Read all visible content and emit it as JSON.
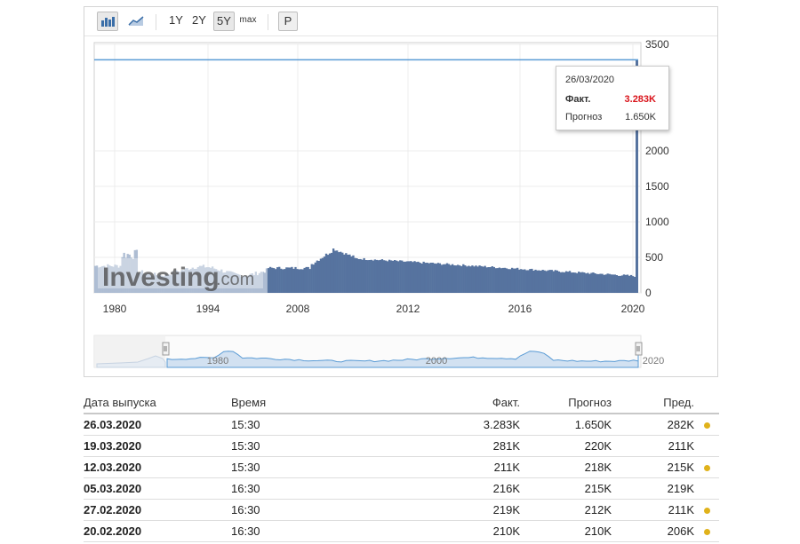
{
  "toolbar": {
    "bar_icon": "bar-chart-icon",
    "line_icon": "line-chart-icon",
    "ranges": [
      "1Y",
      "2Y",
      "5Y",
      "max"
    ],
    "selected_range": "5Y",
    "p_label": "P"
  },
  "chart_data": {
    "type": "bar",
    "y_ticks": [
      "3500",
      "2000",
      "1500",
      "1000",
      "500",
      "0"
    ],
    "x_ticks": [
      "1980",
      "1994",
      "2008",
      "2012",
      "2016",
      "2020"
    ],
    "ylim": [
      0,
      3500
    ],
    "spike_value": 3283,
    "grid": true,
    "watermark": "Investing.com",
    "navigator_labels": [
      "1980",
      "2000",
      "2020"
    ],
    "colors": {
      "bars": "#56739f",
      "bars_faded": "#aebdd3",
      "line": "#5a9bd5"
    }
  },
  "tooltip": {
    "date": "26/03/2020",
    "actual_label": "Факт.",
    "actual_value": "3.283K",
    "forecast_label": "Прогноз",
    "forecast_value": "1.650K"
  },
  "table": {
    "headers": {
      "date": "Дата выпуска",
      "time": "Время",
      "actual": "Факт.",
      "forecast": "Прогноз",
      "previous": "Пред."
    },
    "rows": [
      {
        "date": "26.03.2020",
        "time": "15:30",
        "actual": "3.283K",
        "actual_color": "red",
        "forecast": "1.650K",
        "previous": "282K",
        "previous_color": "red",
        "dot": true
      },
      {
        "date": "19.03.2020",
        "time": "15:30",
        "actual": "281K",
        "actual_color": "red",
        "forecast": "220K",
        "previous": "211K",
        "previous_color": "black",
        "dot": false
      },
      {
        "date": "12.03.2020",
        "time": "15:30",
        "actual": "211K",
        "actual_color": "green",
        "forecast": "218K",
        "previous": "215K",
        "previous_color": "green",
        "dot": true
      },
      {
        "date": "05.03.2020",
        "time": "16:30",
        "actual": "216K",
        "actual_color": "red",
        "forecast": "215K",
        "previous": "219K",
        "previous_color": "black",
        "dot": false
      },
      {
        "date": "27.02.2020",
        "time": "16:30",
        "actual": "219K",
        "actual_color": "red",
        "forecast": "212K",
        "previous": "211K",
        "previous_color": "red",
        "dot": true
      },
      {
        "date": "20.02.2020",
        "time": "16:30",
        "actual": "210K",
        "actual_color": "black",
        "forecast": "210K",
        "previous": "206K",
        "previous_color": "red",
        "dot": true
      }
    ]
  }
}
